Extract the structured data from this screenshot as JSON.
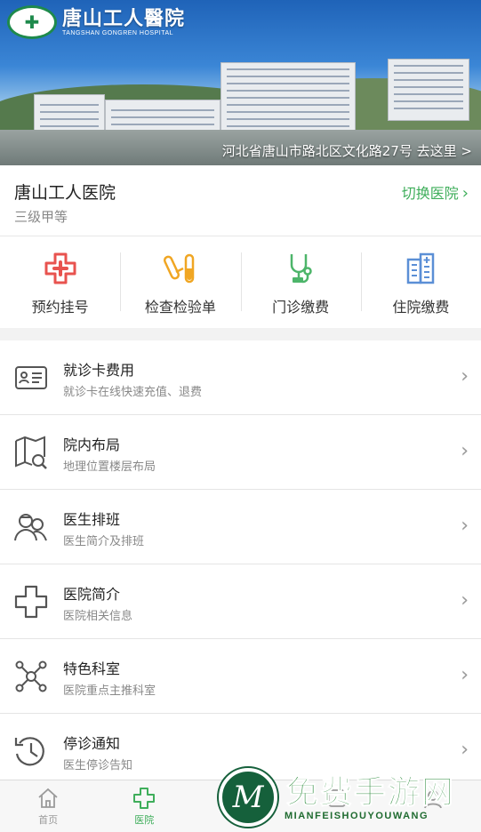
{
  "banner": {
    "logo_name": "唐山工人醫院",
    "logo_subtitle": "TANGSHAN GONGREN HOSPITAL",
    "address": "河北省唐山市路北区文化路27号 去这里 >"
  },
  "hospital": {
    "name": "唐山工人医院",
    "level": "三级甲等",
    "switch_label": "切换医院",
    "switch_chevron": "›"
  },
  "quick_actions": [
    {
      "label": "预约挂号",
      "icon": "red-cross-icon"
    },
    {
      "label": "检查检验单",
      "icon": "test-tube-icon"
    },
    {
      "label": "门诊缴费",
      "icon": "stethoscope-icon"
    },
    {
      "label": "住院缴费",
      "icon": "hospital-building-icon"
    }
  ],
  "menu": [
    {
      "title": "就诊卡费用",
      "subtitle": "就诊卡在线快速充值、退费",
      "icon": "id-card-icon"
    },
    {
      "title": "院内布局",
      "subtitle": "地理位置楼层布局",
      "icon": "map-search-icon"
    },
    {
      "title": "医生排班",
      "subtitle": "医生简介及排班",
      "icon": "doctors-icon"
    },
    {
      "title": "医院简介",
      "subtitle": "医院相关信息",
      "icon": "cross-outline-icon"
    },
    {
      "title": "特色科室",
      "subtitle": "医院重点主推科室",
      "icon": "network-icon"
    },
    {
      "title": "停诊通知",
      "subtitle": "医生停诊告知",
      "icon": "clock-history-icon"
    }
  ],
  "menu_arrow": "›",
  "tabs": [
    {
      "label": "首页",
      "icon": "home-icon",
      "active": false
    },
    {
      "label": "医院",
      "icon": "hospital-cross-icon",
      "active": true
    },
    {
      "label": "",
      "icon": "tab-icon",
      "active": false
    },
    {
      "label": "",
      "icon": "tab-icon",
      "active": false
    },
    {
      "label": "",
      "icon": "tab-icon",
      "active": false
    }
  ],
  "watermark": {
    "title": "免费手游网",
    "subtitle": "MIANFEISHOUYOUWANG",
    "logo_letter": "M"
  },
  "colors": {
    "accent_green": "#3fae5b",
    "red_icon": "#e8534f",
    "orange_icon": "#f0a623",
    "blue_icon": "#5b8fd6"
  }
}
